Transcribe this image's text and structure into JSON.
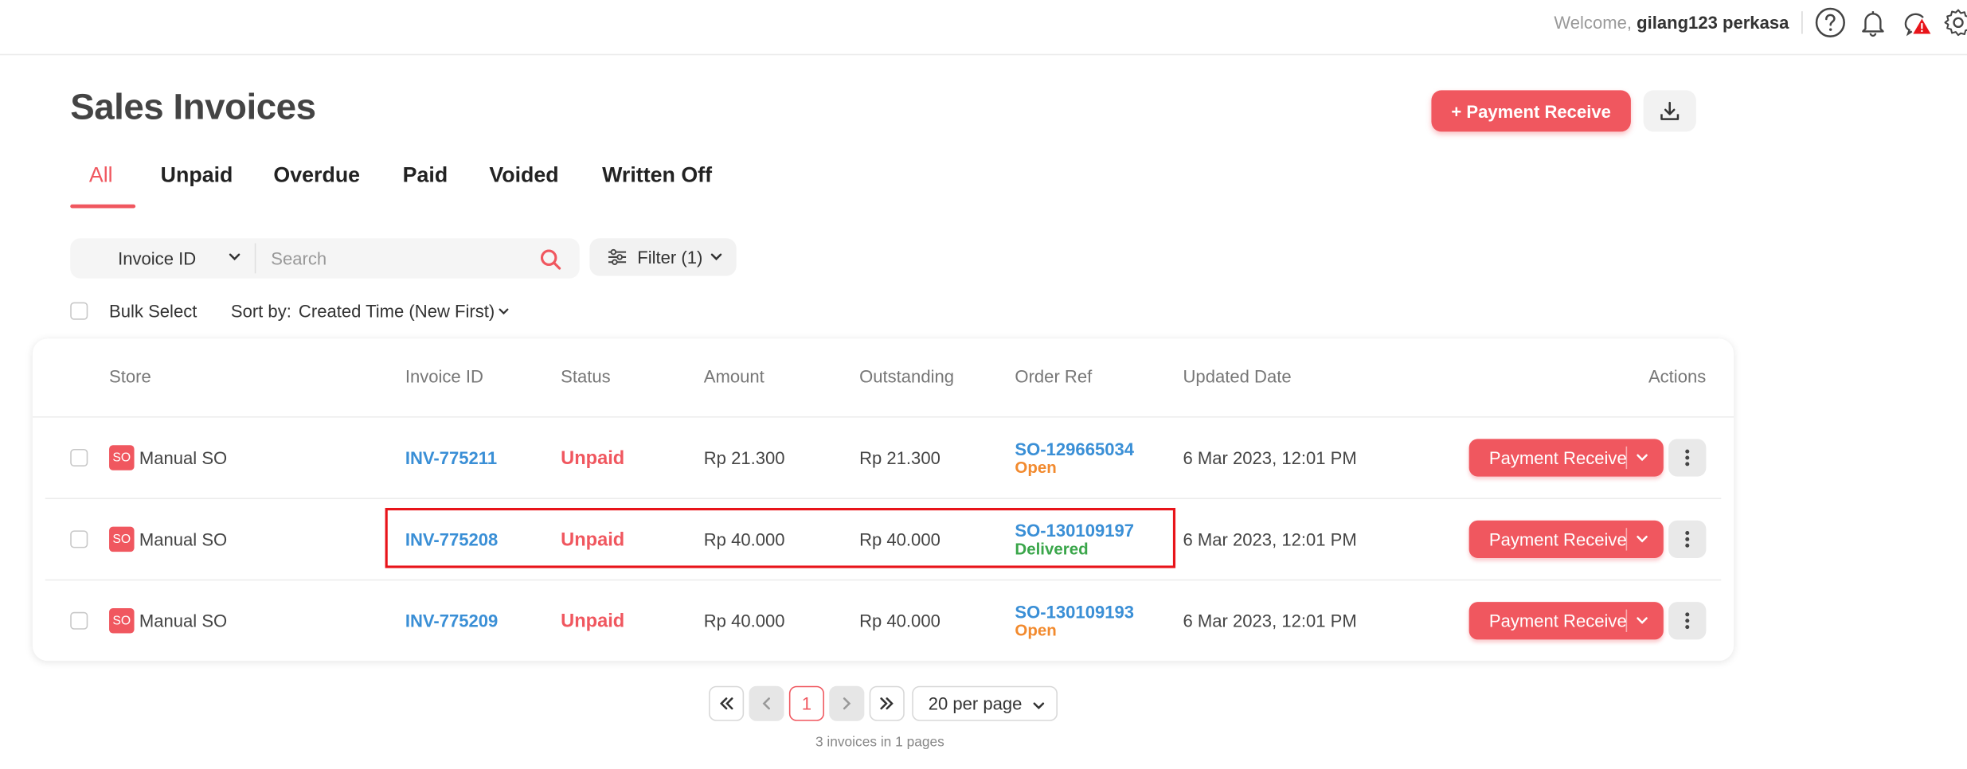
{
  "header": {
    "welcome_prefix": "Welcome,",
    "user_name": "gilang123 perkasa",
    "icons": [
      "help-circle-icon",
      "bell-icon",
      "alert-notification-icon",
      "gear-icon"
    ]
  },
  "page": {
    "title": "Sales Invoices",
    "primary_action": "+ Payment Receive",
    "download_icon": "download-icon"
  },
  "tabs": [
    {
      "label": "All",
      "active": true
    },
    {
      "label": "Unpaid",
      "active": false
    },
    {
      "label": "Overdue",
      "active": false
    },
    {
      "label": "Paid",
      "active": false
    },
    {
      "label": "Voided",
      "active": false
    },
    {
      "label": "Written Off",
      "active": false
    }
  ],
  "search": {
    "field_select": "Invoice ID",
    "placeholder": "Search",
    "filter_label": "Filter (1)"
  },
  "list_controls": {
    "bulk_select": "Bulk Select",
    "sort_by_label": "Sort by:",
    "sort_by_value": "Created Time (New First)"
  },
  "table": {
    "columns": [
      "Store",
      "Invoice ID",
      "Status",
      "Amount",
      "Outstanding",
      "Order Ref",
      "Updated Date",
      "Actions"
    ],
    "rows": [
      {
        "store_badge": "SO",
        "store": "Manual SO",
        "invoice_id": "INV-775211",
        "status": "Unpaid",
        "amount": "Rp 21.300",
        "outstanding": "Rp 21.300",
        "order_ref": "SO-129665034",
        "order_status": "Open",
        "updated": "6 Mar 2023, 12:01 PM",
        "action": "Payment Receive"
      },
      {
        "store_badge": "SO",
        "store": "Manual SO",
        "invoice_id": "INV-775208",
        "status": "Unpaid",
        "amount": "Rp 40.000",
        "outstanding": "Rp 40.000",
        "order_ref": "SO-130109197",
        "order_status": "Delivered",
        "updated": "6 Mar 2023, 12:01 PM",
        "action": "Payment Receive"
      },
      {
        "store_badge": "SO",
        "store": "Manual SO",
        "invoice_id": "INV-775209",
        "status": "Unpaid",
        "amount": "Rp 40.000",
        "outstanding": "Rp 40.000",
        "order_ref": "SO-130109193",
        "order_status": "Open",
        "updated": "6 Mar 2023, 12:01 PM",
        "action": "Payment Receive"
      }
    ]
  },
  "pagination": {
    "current_page": "1",
    "per_page": "20 per page",
    "summary": "3 invoices in 1 pages"
  },
  "colors": {
    "accent": "#f0575f",
    "link": "#3a8fd6",
    "open": "#f28a2e",
    "delivered": "#3aa64a",
    "highlight_box": "#e8141a"
  }
}
